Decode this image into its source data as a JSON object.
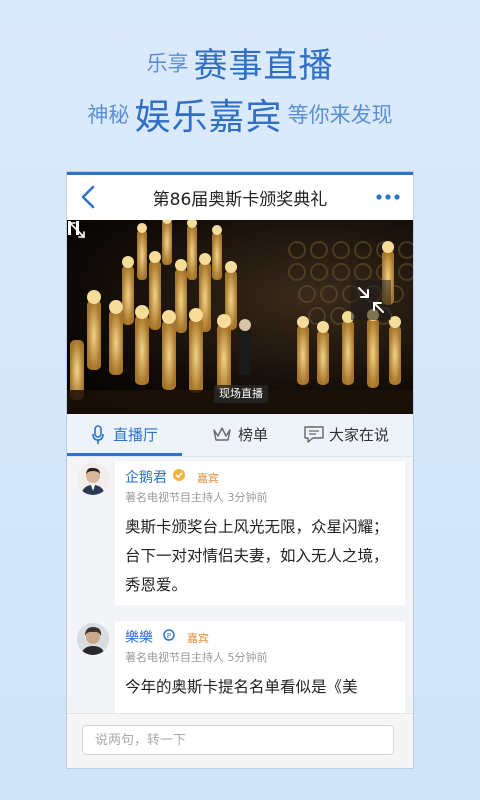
{
  "promo": {
    "line1_small": "乐享",
    "line1_big": "赛事直播",
    "line2_small_left": "神秘",
    "line2_big": "娱乐嘉宾",
    "line2_small_right": "等你来发现"
  },
  "header": {
    "title": "第86届奥斯卡颁奖典礼"
  },
  "video": {
    "live_badge": "现场直播"
  },
  "tabs": [
    {
      "label": "直播厅",
      "icon": "microphone-icon",
      "active": true
    },
    {
      "label": "榜单",
      "icon": "crown-icon"
    },
    {
      "label": "大家在说",
      "icon": "chat-bubble-icon"
    }
  ],
  "feed": [
    {
      "name": "企鹅君",
      "badge": "嘉宾",
      "meta": "著名电视节目主持人  3分钟前",
      "content": "奥斯卡颁奖台上风光无限，众星闪耀；台下一对对情侣夫妻，如入无人之境，秀恩爱。"
    },
    {
      "name": "樂樂",
      "badge": "嘉宾",
      "meta": "著名电视节目主持人  5分钟前",
      "content": "今年的奥斯卡提名名单看似是《美"
    }
  ],
  "input": {
    "placeholder": "说两句，转一下"
  },
  "colors": {
    "accent": "#2d73c8",
    "guest_badge": "#e58d3a"
  }
}
